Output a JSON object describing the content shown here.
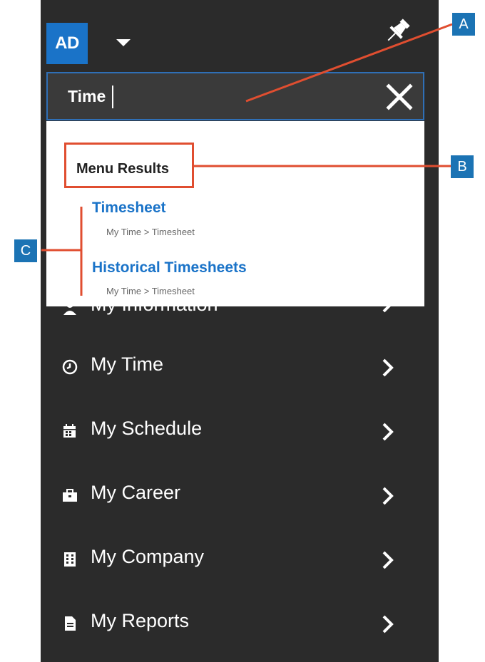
{
  "header": {
    "avatar_initials": "AD",
    "avatar_color": "#1a73c8"
  },
  "search": {
    "value": "Time",
    "accent": "#2f6fb6"
  },
  "dropdown": {
    "header": "Menu Results",
    "results": [
      {
        "title": "Timesheet",
        "path": "My Time > Timesheet"
      },
      {
        "title": "Historical Timesheets",
        "path": "My Time > Timesheet"
      }
    ]
  },
  "menu": {
    "partial_label": "My Information",
    "items": [
      {
        "label": "My Time",
        "icon": "clock-icon"
      },
      {
        "label": "My Schedule",
        "icon": "calendar-icon"
      },
      {
        "label": "My Career",
        "icon": "briefcase-icon"
      },
      {
        "label": "My Company",
        "icon": "building-icon"
      },
      {
        "label": "My Reports",
        "icon": "document-icon"
      }
    ]
  },
  "annotations": {
    "a": "A",
    "b": "B",
    "c": "C",
    "color": "#e04e30",
    "badge_color": "#1b73b4"
  }
}
